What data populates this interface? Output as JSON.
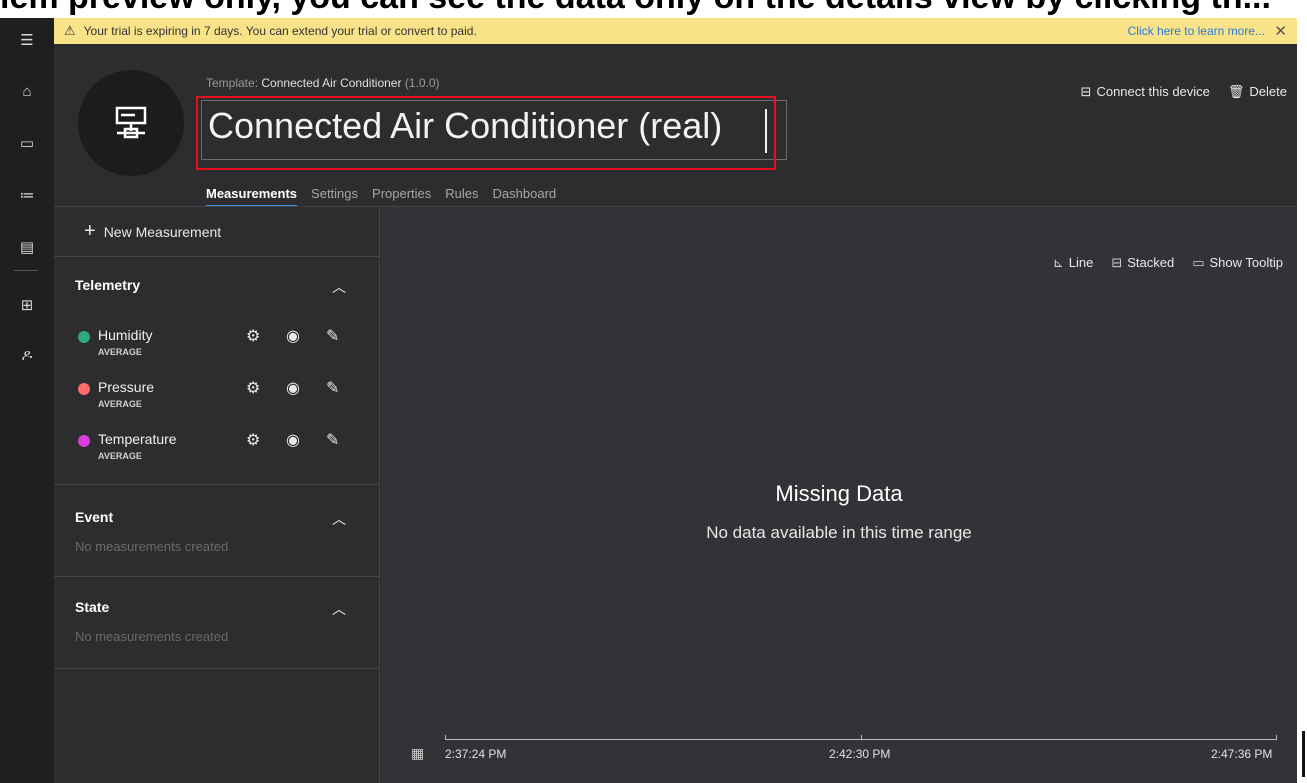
{
  "top_strip_text": "lem preview only, you can see the data only on the details view by clicking th...",
  "banner": {
    "warning_icon": "warning-icon",
    "message": "Your trial is expiring in 7 days. You can extend your trial or convert to paid.",
    "learn_more": "Click here to learn more...",
    "close": "✕"
  },
  "rail": {
    "items": [
      "menu-icon",
      "home-icon",
      "device-icon",
      "rules-icon",
      "analytics-icon",
      "dashboard-icon",
      "users-icon"
    ]
  },
  "header": {
    "template_label": "Template:",
    "template_name": "Connected Air Conditioner",
    "template_version": "(1.0.0)",
    "device_title": "Connected Air Conditioner (real)",
    "actions": {
      "connect": "Connect this device",
      "delete": "Delete"
    },
    "tabs": [
      {
        "label": "Measurements",
        "active": true
      },
      {
        "label": "Settings",
        "active": false
      },
      {
        "label": "Properties",
        "active": false
      },
      {
        "label": "Rules",
        "active": false
      },
      {
        "label": "Dashboard",
        "active": false
      }
    ]
  },
  "measurements": {
    "new_label": "New Measurement",
    "telemetry": {
      "title": "Telemetry",
      "items": [
        {
          "name": "Humidity",
          "agg": "AVERAGE",
          "color": "#2fa97c"
        },
        {
          "name": "Pressure",
          "agg": "AVERAGE",
          "color": "#ff6b6b"
        },
        {
          "name": "Temperature",
          "agg": "AVERAGE",
          "color": "#d63fd9"
        }
      ]
    },
    "event": {
      "title": "Event",
      "empty": "No measurements created"
    },
    "state": {
      "title": "State",
      "empty": "No measurements created"
    }
  },
  "chart": {
    "tools": {
      "line": "Line",
      "stacked": "Stacked",
      "tooltip": "Show Tooltip"
    },
    "missing_title": "Missing Data",
    "missing_sub": "No data available in this time range",
    "time_labels": [
      "2:37:24 PM",
      "2:42:30 PM",
      "2:47:36 PM"
    ]
  }
}
